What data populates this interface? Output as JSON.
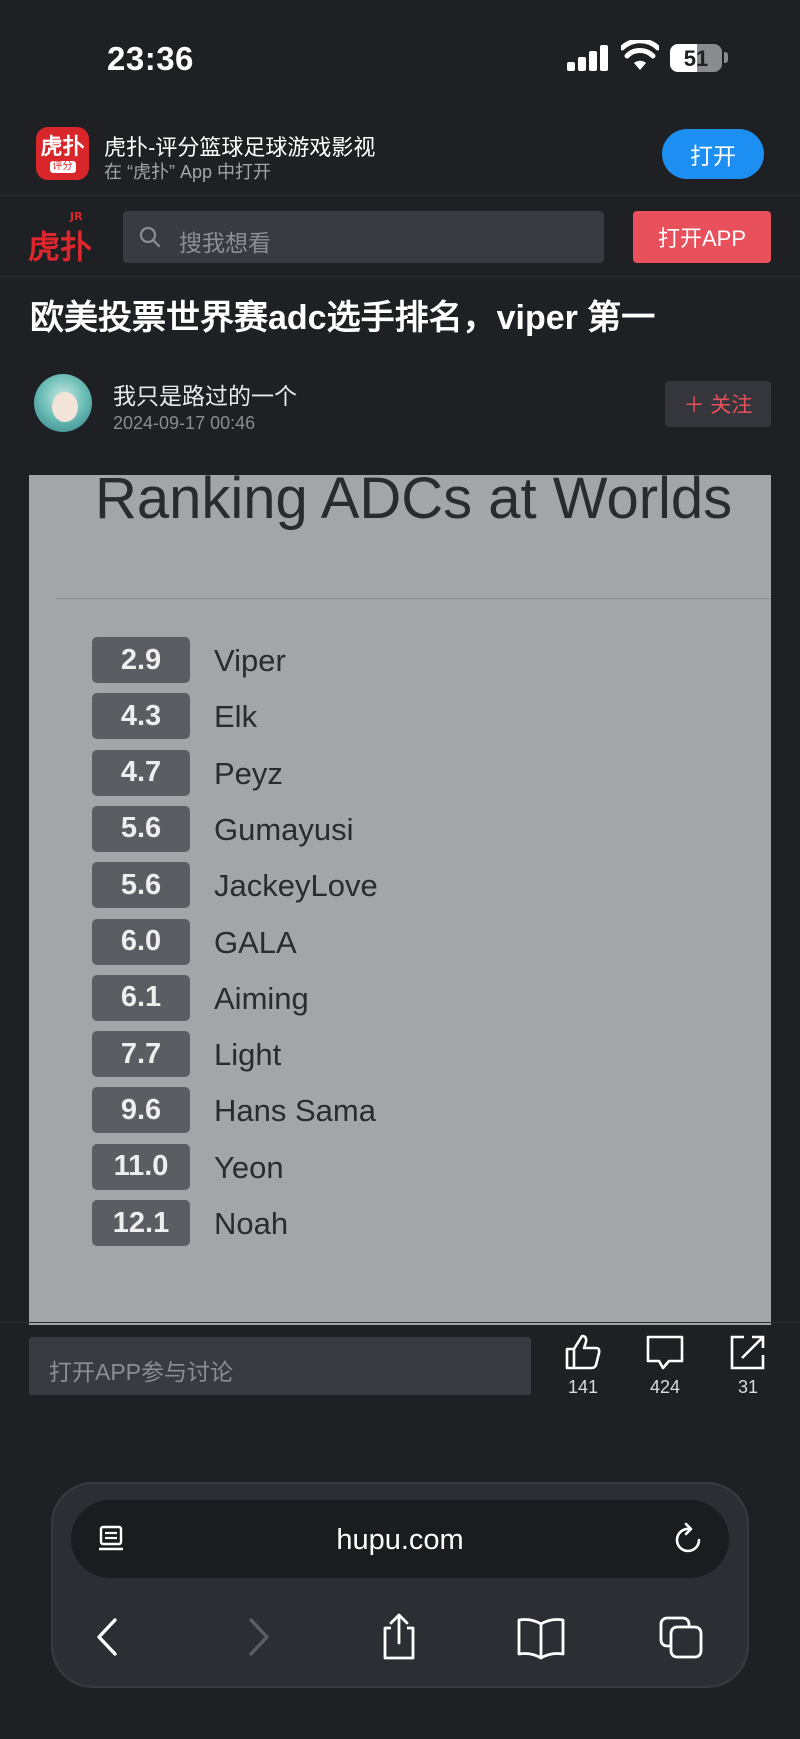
{
  "status_bar": {
    "time": "23:36",
    "battery": "51",
    "battery_level": 0.51
  },
  "app_banner": {
    "title": "虎扑-评分篮球足球游戏影视",
    "subtitle": "在 “虎扑” App 中打开",
    "open_label": "打开",
    "icon_big": "虎扑",
    "icon_small": "评分"
  },
  "site_header": {
    "logo_text": "虎扑",
    "logo_badge": "JR",
    "search_placeholder": "搜我想看",
    "open_app_label": "打开APP"
  },
  "post": {
    "title": "欧美投票世界赛adc选手排名，viper 第一",
    "author": "我只是路过的一个",
    "date": "2024-09-17 00:46",
    "follow_label": "＋ 关注"
  },
  "image": {
    "heading": "Ranking ADCs at Worlds",
    "rankings": [
      {
        "score": "2.9",
        "name": "Viper"
      },
      {
        "score": "4.3",
        "name": "Elk"
      },
      {
        "score": "4.7",
        "name": "Peyz"
      },
      {
        "score": "5.6",
        "name": "Gumayusi"
      },
      {
        "score": "5.6",
        "name": "JackeyLove"
      },
      {
        "score": "6.0",
        "name": "GALA"
      },
      {
        "score": "6.1",
        "name": "Aiming"
      },
      {
        "score": "7.7",
        "name": "Light"
      },
      {
        "score": "9.6",
        "name": "Hans Sama"
      },
      {
        "score": "11.0",
        "name": "Yeon"
      },
      {
        "score": "12.1",
        "name": "Noah"
      }
    ]
  },
  "bottom_bar": {
    "discuss_placeholder": "打开APP参与讨论",
    "likes": "141",
    "comments": "424",
    "shares": "31"
  },
  "safari": {
    "url": "hupu.com"
  }
}
